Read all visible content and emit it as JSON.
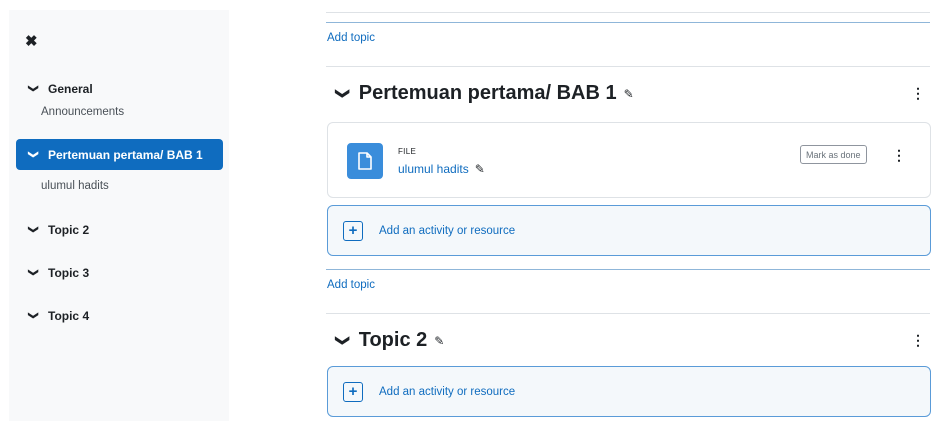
{
  "sidebar": {
    "close_icon": "close-icon",
    "sections": [
      {
        "label": "General",
        "active": false
      },
      {
        "label": "Pertemuan pertama/ BAB 1",
        "active": true
      },
      {
        "label": "Topic 2",
        "active": false
      },
      {
        "label": "Topic 3",
        "active": false
      },
      {
        "label": "Topic 4",
        "active": false
      }
    ],
    "subitems": {
      "general": "Announcements",
      "bab1": "ulumul hadits"
    }
  },
  "main": {
    "add_topic_label": "Add topic",
    "sections": [
      {
        "title": "Pertemuan pertama/ BAB 1",
        "activities": [
          {
            "type_label": "FILE",
            "name": "ulumul hadits",
            "completion_button": "Mark as done"
          }
        ],
        "add_activity_label": "Add an activity or resource"
      },
      {
        "title": "Topic 2",
        "add_activity_label": "Add an activity or resource"
      }
    ]
  },
  "colors": {
    "accent": "#0f6cbf",
    "file_icon_bg": "#3a8ddb"
  }
}
